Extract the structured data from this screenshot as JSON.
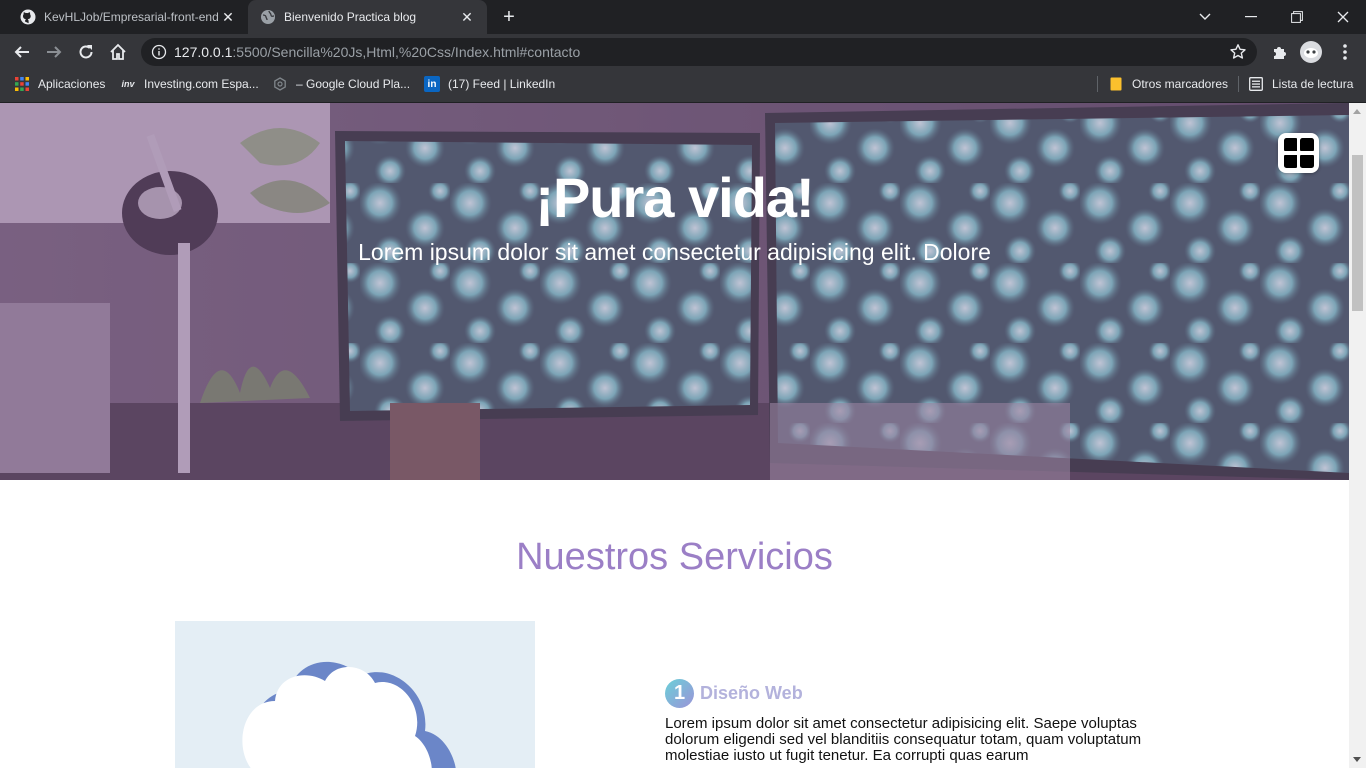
{
  "browser": {
    "tabs": [
      {
        "title": "KevHLJob/Empresarial-front-end",
        "icon": "github-icon",
        "active": false
      },
      {
        "title": "Bienvenido Practica blog",
        "icon": "globe-icon",
        "active": true
      }
    ],
    "new_tab_label": "+",
    "url": {
      "host": "127.0.0.1",
      "path": ":5500/Sencilla%20Js,Html,%20Css/Index.html#contacto"
    },
    "bookmarks": [
      {
        "label": "Aplicaciones",
        "icon": "apps-grid-icon"
      },
      {
        "label": "Investing.com Espa...",
        "icon": "investing-icon"
      },
      {
        "label": "– Google Cloud Pla...",
        "icon": "google-cloud-icon"
      },
      {
        "label": "(17) Feed | LinkedIn",
        "icon": "linkedin-icon"
      }
    ],
    "bookmarks_right": [
      {
        "label": "Otros marcadores",
        "icon": "folder-icon"
      },
      {
        "label": "Lista de lectura",
        "icon": "reading-list-icon"
      }
    ],
    "icon_labels": {
      "linkedin": "in",
      "investing": "inv"
    }
  },
  "page": {
    "hero": {
      "title": "¡Pura vida!",
      "subtitle": "Lorem ipsum dolor sit amet consectetur adipisicing elit. Dolore"
    },
    "services": {
      "title": "Nuestros Servicios",
      "items": [
        {
          "number": "1",
          "name": "Diseño Web",
          "text": "Lorem ipsum dolor sit amet consectetur adipisicing elit. Saepe voluptas dolorum eligendi sed vel blanditiis consequatur totam, quam voluptatum molestiae iusto ut fugit tenetur. Ea corrupti quas earum"
        }
      ]
    }
  },
  "colors": {
    "accent": "#9b7fc6",
    "service_name": "#b3b2dc",
    "chrome_dark": "#202124",
    "chrome_toolbar": "#35363a"
  }
}
